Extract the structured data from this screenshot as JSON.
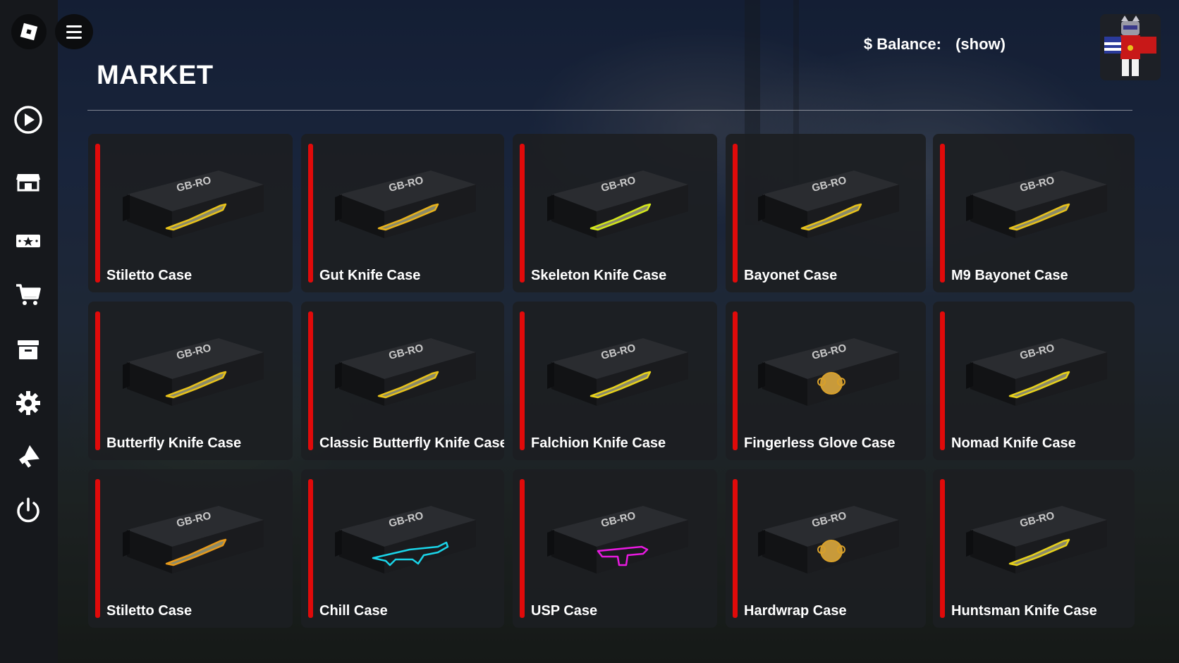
{
  "app": {
    "title": "MARKET",
    "balance_label": "$ Balance:",
    "balance_value": "(show)"
  },
  "sidebar": {
    "items": [
      {
        "name": "play"
      },
      {
        "name": "shop"
      },
      {
        "name": "tickets"
      },
      {
        "name": "cart"
      },
      {
        "name": "inventory"
      },
      {
        "name": "settings"
      },
      {
        "name": "announcements"
      },
      {
        "name": "power"
      }
    ]
  },
  "cases": [
    {
      "name": "Stiletto Case",
      "item": "knife",
      "glow": "#e8c21a"
    },
    {
      "name": "Gut Knife Case",
      "item": "knife",
      "glow": "#e8b21a"
    },
    {
      "name": "Skeleton Knife Case",
      "item": "knife",
      "glow": "#d4e81a"
    },
    {
      "name": "Bayonet Case",
      "item": "knife",
      "glow": "#e8c21a"
    },
    {
      "name": "M9 Bayonet Case",
      "item": "knife",
      "glow": "#e8c21a"
    },
    {
      "name": "Butterfly Knife Case",
      "item": "knife",
      "glow": "#e8c21a"
    },
    {
      "name": "Classic Butterfly Knife Case",
      "item": "knife",
      "glow": "#e8c21a"
    },
    {
      "name": "Falchion Knife Case",
      "item": "knife",
      "glow": "#e8d21a"
    },
    {
      "name": "Fingerless Glove Case",
      "item": "glove",
      "glow": "#d8a02a"
    },
    {
      "name": "Nomad Knife Case",
      "item": "knife",
      "glow": "#e8d21a"
    },
    {
      "name": "Stiletto Case",
      "item": "knife",
      "glow": "#e89a1a"
    },
    {
      "name": "Chill Case",
      "item": "rifle",
      "glow": "#1ad4e8"
    },
    {
      "name": "USP Case",
      "item": "pistol",
      "glow": "#e81ae0"
    },
    {
      "name": "Hardwrap Case",
      "item": "glove",
      "glow": "#d8a02a"
    },
    {
      "name": "Huntsman Knife Case",
      "item": "knife",
      "glow": "#e8d21a"
    }
  ],
  "case_brand": "GB-RO",
  "colors": {
    "accent": "#e00a0a",
    "sidebar": "#16181c",
    "card": "#1c1e22"
  }
}
